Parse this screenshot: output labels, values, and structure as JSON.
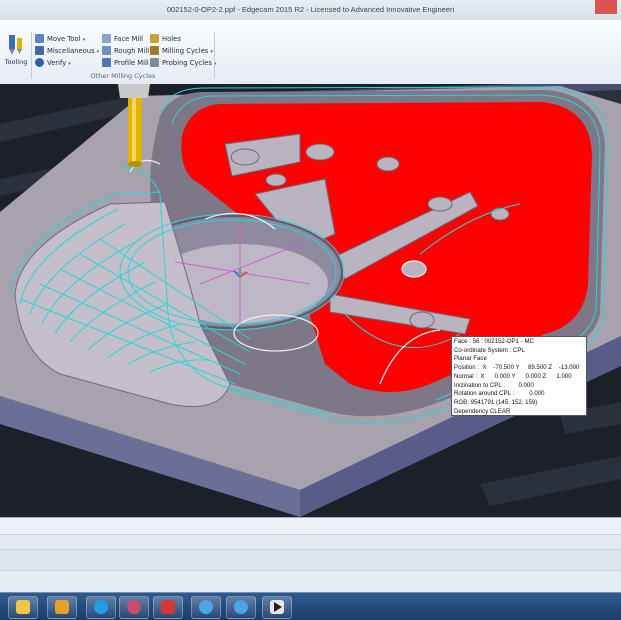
{
  "window": {
    "title": "002152-0-OP2-2.ppf - Edgecam 2015 R2  -  Licensed to Advanced Innovative Engineeri"
  },
  "ribbon": {
    "tooling_label": "Tooling",
    "col1": [
      {
        "label": "Move Tool",
        "icon": "move-tool-icon",
        "dropdown": true
      },
      {
        "label": "Miscellaneous",
        "icon": "miscellaneous-icon",
        "dropdown": true
      },
      {
        "label": "Verify",
        "icon": "verify-icon",
        "dropdown": true
      }
    ],
    "col2": [
      {
        "label": "Face Mill",
        "icon": "face-mill-icon"
      },
      {
        "label": "Rough Mill",
        "icon": "rough-mill-icon"
      },
      {
        "label": "Profile Mill",
        "icon": "profile-mill-icon"
      }
    ],
    "col3": [
      {
        "label": "Holes",
        "icon": "holes-icon"
      },
      {
        "label": "Milling Cycles",
        "icon": "milling-cycles-icon",
        "dropdown": true
      },
      {
        "label": "Probing Cycles",
        "icon": "probing-cycles-icon",
        "dropdown": true
      }
    ],
    "group_label": "Other Milling Cycles",
    "caret": "▾"
  },
  "info": {
    "lines": [
      "Face : 56 : 002152-OP1 - MC",
      "Co-ordinate System : CPL",
      "Planar Face",
      "Position :  X    -70.500 Y     89.500 Z    -13.000",
      "Normal :  X      0.000 Y      0.000 Z      1.000",
      "Inclination to CPL :        0.000",
      "Rotation around CPL :         0.000",
      "RGB: 9541791 (145, 152, 159)",
      "Dependency CLEAR"
    ]
  },
  "colors": {
    "stock_top": "#a7a2ad",
    "stock_side": "#6a6f98",
    "pocket_red": "#ff0000",
    "toolpath_cyan": "#27d6d6",
    "tool_yellow": "#e0b400",
    "background": "#1e2430"
  },
  "taskbar": [
    {
      "icon": "windows-explorer-icon"
    },
    {
      "icon": "outlook-icon"
    },
    {
      "icon": "skype-icon"
    },
    {
      "icon": "paint-icon"
    },
    {
      "icon": "solidworks-icon"
    },
    {
      "icon": "internet-explorer-icon"
    },
    {
      "icon": "internet-explorer-icon"
    },
    {
      "icon": "media-player-icon"
    }
  ]
}
